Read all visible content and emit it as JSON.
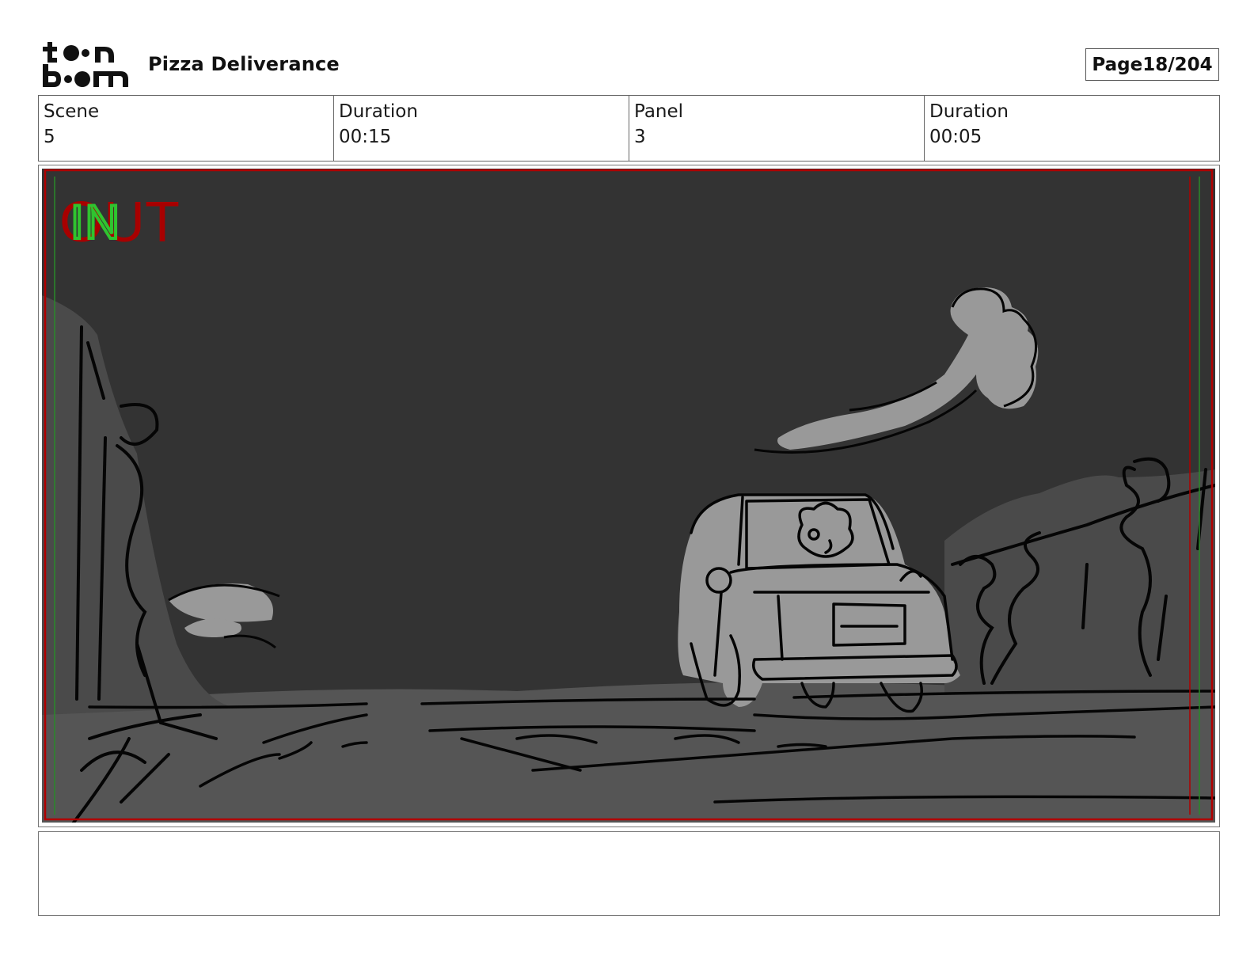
{
  "header": {
    "logo_text": "toonboom",
    "project_title": "Pizza Deliverance",
    "page_label": "Page",
    "page_number": "18/204"
  },
  "meta": {
    "scene_label": "Scene",
    "scene_value": "5",
    "scene_duration_label": "Duration",
    "scene_duration_value": "00:15",
    "panel_label": "Panel",
    "panel_value": "3",
    "panel_duration_label": "Duration",
    "panel_duration_value": "00:05"
  },
  "panel": {
    "overlay_in_text": "IN",
    "overlay_out_text": "OUT"
  },
  "notes": {
    "text": ""
  },
  "colors": {
    "sketch_background": "#333333",
    "sketch_fill": "#9a9a9a",
    "safe_area_red": "#b00000",
    "safe_area_green": "#2a8a2a"
  }
}
